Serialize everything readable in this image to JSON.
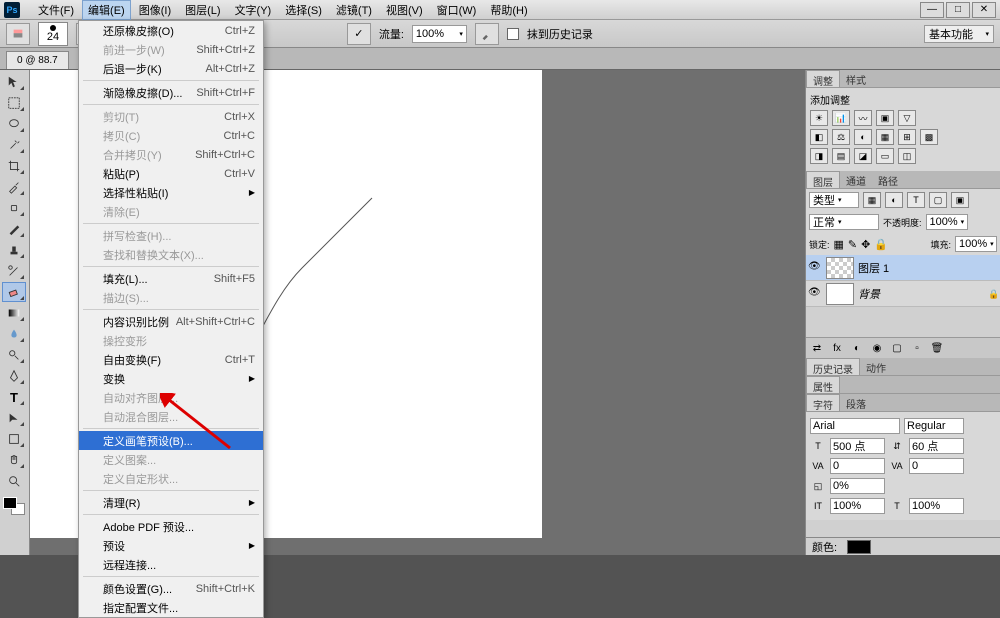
{
  "app": {
    "logo": "Ps"
  },
  "menubar": [
    "文件(F)",
    "编辑(E)",
    "图像(I)",
    "图层(L)",
    "文字(Y)",
    "选择(S)",
    "滤镜(T)",
    "视图(V)",
    "窗口(W)",
    "帮助(H)"
  ],
  "options": {
    "brush_size": "24",
    "flow_label": "流量:",
    "flow_value": "100%",
    "history_label": "抹到历史记录"
  },
  "workspace": "基本功能",
  "tab_title": "0 @ 88.7",
  "edit_menu": [
    {
      "label": "还原橡皮擦(O)",
      "shortcut": "Ctrl+Z"
    },
    {
      "label": "前进一步(W)",
      "shortcut": "Shift+Ctrl+Z",
      "disabled": true
    },
    {
      "label": "后退一步(K)",
      "shortcut": "Alt+Ctrl+Z"
    },
    {
      "sep": true
    },
    {
      "label": "渐隐橡皮擦(D)...",
      "shortcut": "Shift+Ctrl+F"
    },
    {
      "sep": true
    },
    {
      "label": "剪切(T)",
      "shortcut": "Ctrl+X",
      "disabled": true
    },
    {
      "label": "拷贝(C)",
      "shortcut": "Ctrl+C",
      "disabled": true
    },
    {
      "label": "合并拷贝(Y)",
      "shortcut": "Shift+Ctrl+C",
      "disabled": true
    },
    {
      "label": "粘贴(P)",
      "shortcut": "Ctrl+V"
    },
    {
      "label": "选择性粘贴(I)",
      "arrow": true
    },
    {
      "label": "清除(E)",
      "disabled": true
    },
    {
      "sep": true
    },
    {
      "label": "拼写检查(H)...",
      "disabled": true
    },
    {
      "label": "查找和替换文本(X)...",
      "disabled": true
    },
    {
      "sep": true
    },
    {
      "label": "填充(L)...",
      "shortcut": "Shift+F5"
    },
    {
      "label": "描边(S)...",
      "disabled": true
    },
    {
      "sep": true
    },
    {
      "label": "内容识别比例",
      "shortcut": "Alt+Shift+Ctrl+C"
    },
    {
      "label": "操控变形",
      "disabled": true
    },
    {
      "label": "自由变换(F)",
      "shortcut": "Ctrl+T"
    },
    {
      "label": "变换",
      "arrow": true
    },
    {
      "label": "自动对齐图层...",
      "disabled": true
    },
    {
      "label": "自动混合图层...",
      "disabled": true
    },
    {
      "sep": true
    },
    {
      "label": "定义画笔预设(B)...",
      "highlight": true
    },
    {
      "label": "定义图案...",
      "disabled": true
    },
    {
      "label": "定义自定形状...",
      "disabled": true
    },
    {
      "sep": true
    },
    {
      "label": "清理(R)",
      "arrow": true
    },
    {
      "sep": true
    },
    {
      "label": "Adobe PDF 预设..."
    },
    {
      "label": "预设",
      "arrow": true
    },
    {
      "label": "远程连接..."
    },
    {
      "sep": true
    },
    {
      "label": "颜色设置(G)...",
      "shortcut": "Shift+Ctrl+K"
    },
    {
      "label": "指定配置文件..."
    }
  ],
  "panels": {
    "adjust_tab": "调整",
    "style_tab": "样式",
    "adjust_title": "添加调整",
    "layers_tab": "图层",
    "channels_tab": "通道",
    "paths_tab": "路径",
    "kind": "类型",
    "blend": "正常",
    "opacity_label": "不透明度:",
    "opacity": "100%",
    "lock_label": "锁定:",
    "fill_label": "填充:",
    "fill": "100%",
    "layer1": "图层 1",
    "background": "背景",
    "history_tab": "历史记录",
    "actions_tab": "动作",
    "props_tab": "属性",
    "char_tab": "字符",
    "para_tab": "段落",
    "font": "Arial",
    "style": "Regular",
    "size": "500 点",
    "leading": "60 点",
    "tracking": "0",
    "va": "0",
    "scale": "0%",
    "it": "100%",
    "t": "100%"
  },
  "status": {
    "color_label": "颜色:"
  }
}
